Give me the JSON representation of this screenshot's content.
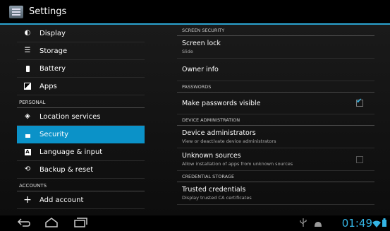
{
  "actionbar": {
    "title": "Settings"
  },
  "left": {
    "items": [
      {
        "label": "Display",
        "icon": "display-icon"
      },
      {
        "label": "Storage",
        "icon": "storage-icon"
      },
      {
        "label": "Battery",
        "icon": "battery-icon"
      },
      {
        "label": "Apps",
        "icon": "apps-icon"
      }
    ],
    "personal_header": "PERSONAL",
    "personal": [
      {
        "label": "Location services",
        "icon": "location-icon"
      },
      {
        "label": "Security",
        "icon": "lock-icon",
        "selected": true
      },
      {
        "label": "Language & input",
        "icon": "keyboard-icon"
      },
      {
        "label": "Backup & reset",
        "icon": "backup-icon"
      }
    ],
    "accounts_header": "ACCOUNTS",
    "add_account": "Add account"
  },
  "right": {
    "screen_security_header": "SCREEN SECURITY",
    "screen_lock": {
      "title": "Screen lock",
      "summary": "Slide"
    },
    "owner_info": "Owner info",
    "passwords_header": "PASSWORDS",
    "make_passwords_visible": {
      "title": "Make passwords visible",
      "checked": true
    },
    "device_admin_header": "DEVICE ADMINISTRATION",
    "device_administrators": {
      "title": "Device administrators",
      "summary": "View or deactivate device administrators"
    },
    "unknown_sources": {
      "title": "Unknown sources",
      "summary": "Allow installation of apps from unknown sources",
      "checked": false
    },
    "credential_header": "CREDENTIAL STORAGE",
    "trusted_credentials": {
      "title": "Trusted credentials",
      "summary": "Display trusted CA certificates"
    }
  },
  "statusbar": {
    "time": "01:49"
  },
  "colors": {
    "accent": "#33b5e5",
    "selection": "#0b92c8"
  }
}
